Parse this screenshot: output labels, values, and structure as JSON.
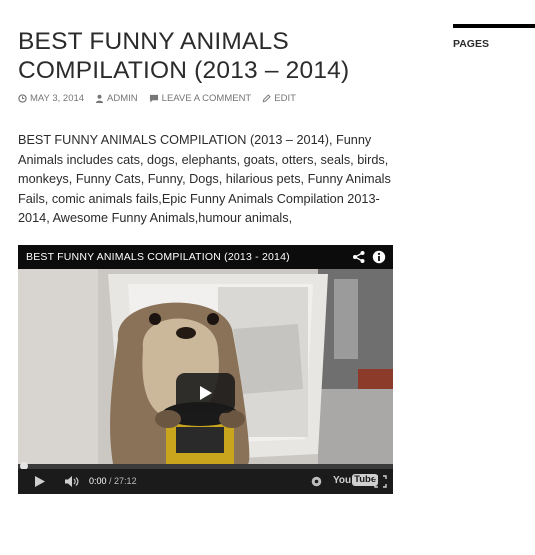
{
  "post": {
    "title": "BEST FUNNY ANIMALS COMPILATION (2013 – 2014)",
    "meta": {
      "date": "MAY 3, 2014",
      "author": "ADMIN",
      "comment": "LEAVE A COMMENT",
      "edit": "EDIT",
      "date_icon": "clock-icon",
      "author_icon": "user-icon",
      "comment_icon": "comment-icon",
      "edit_icon": "pencil-icon"
    },
    "content": "BEST FUNNY ANIMALS COMPILATION (2013 – 2014), Funny Animals includes cats, dogs, elephants, goats, otters, seals, birds, monkeys, Funny Cats, Funny, Dogs, hilarious pets, Funny Animals Fails, comic animals fails,Epic Funny Animals Compilation 2013-2014, Awesome Funny Animals,humour animals,"
  },
  "sidebar": {
    "heading": "PAGES"
  },
  "video": {
    "title": "BEST FUNNY ANIMALS COMPILATION (2013 - 2014)",
    "current_time": "0:00",
    "separator": " / ",
    "duration": "27:12",
    "progress_fraction": 0,
    "logo_you": "You",
    "logo_tube": "Tube",
    "icons": {
      "share": "share-icon",
      "info": "info-icon",
      "play": "play-icon",
      "volume": "volume-icon",
      "settings": "settings-icon",
      "fullscreen": "fullscreen-icon"
    }
  },
  "colors": {
    "text": "#2b2b2b",
    "meta": "#767676",
    "video_bg": "#000000",
    "controls_bg": "#1b1b1b"
  }
}
